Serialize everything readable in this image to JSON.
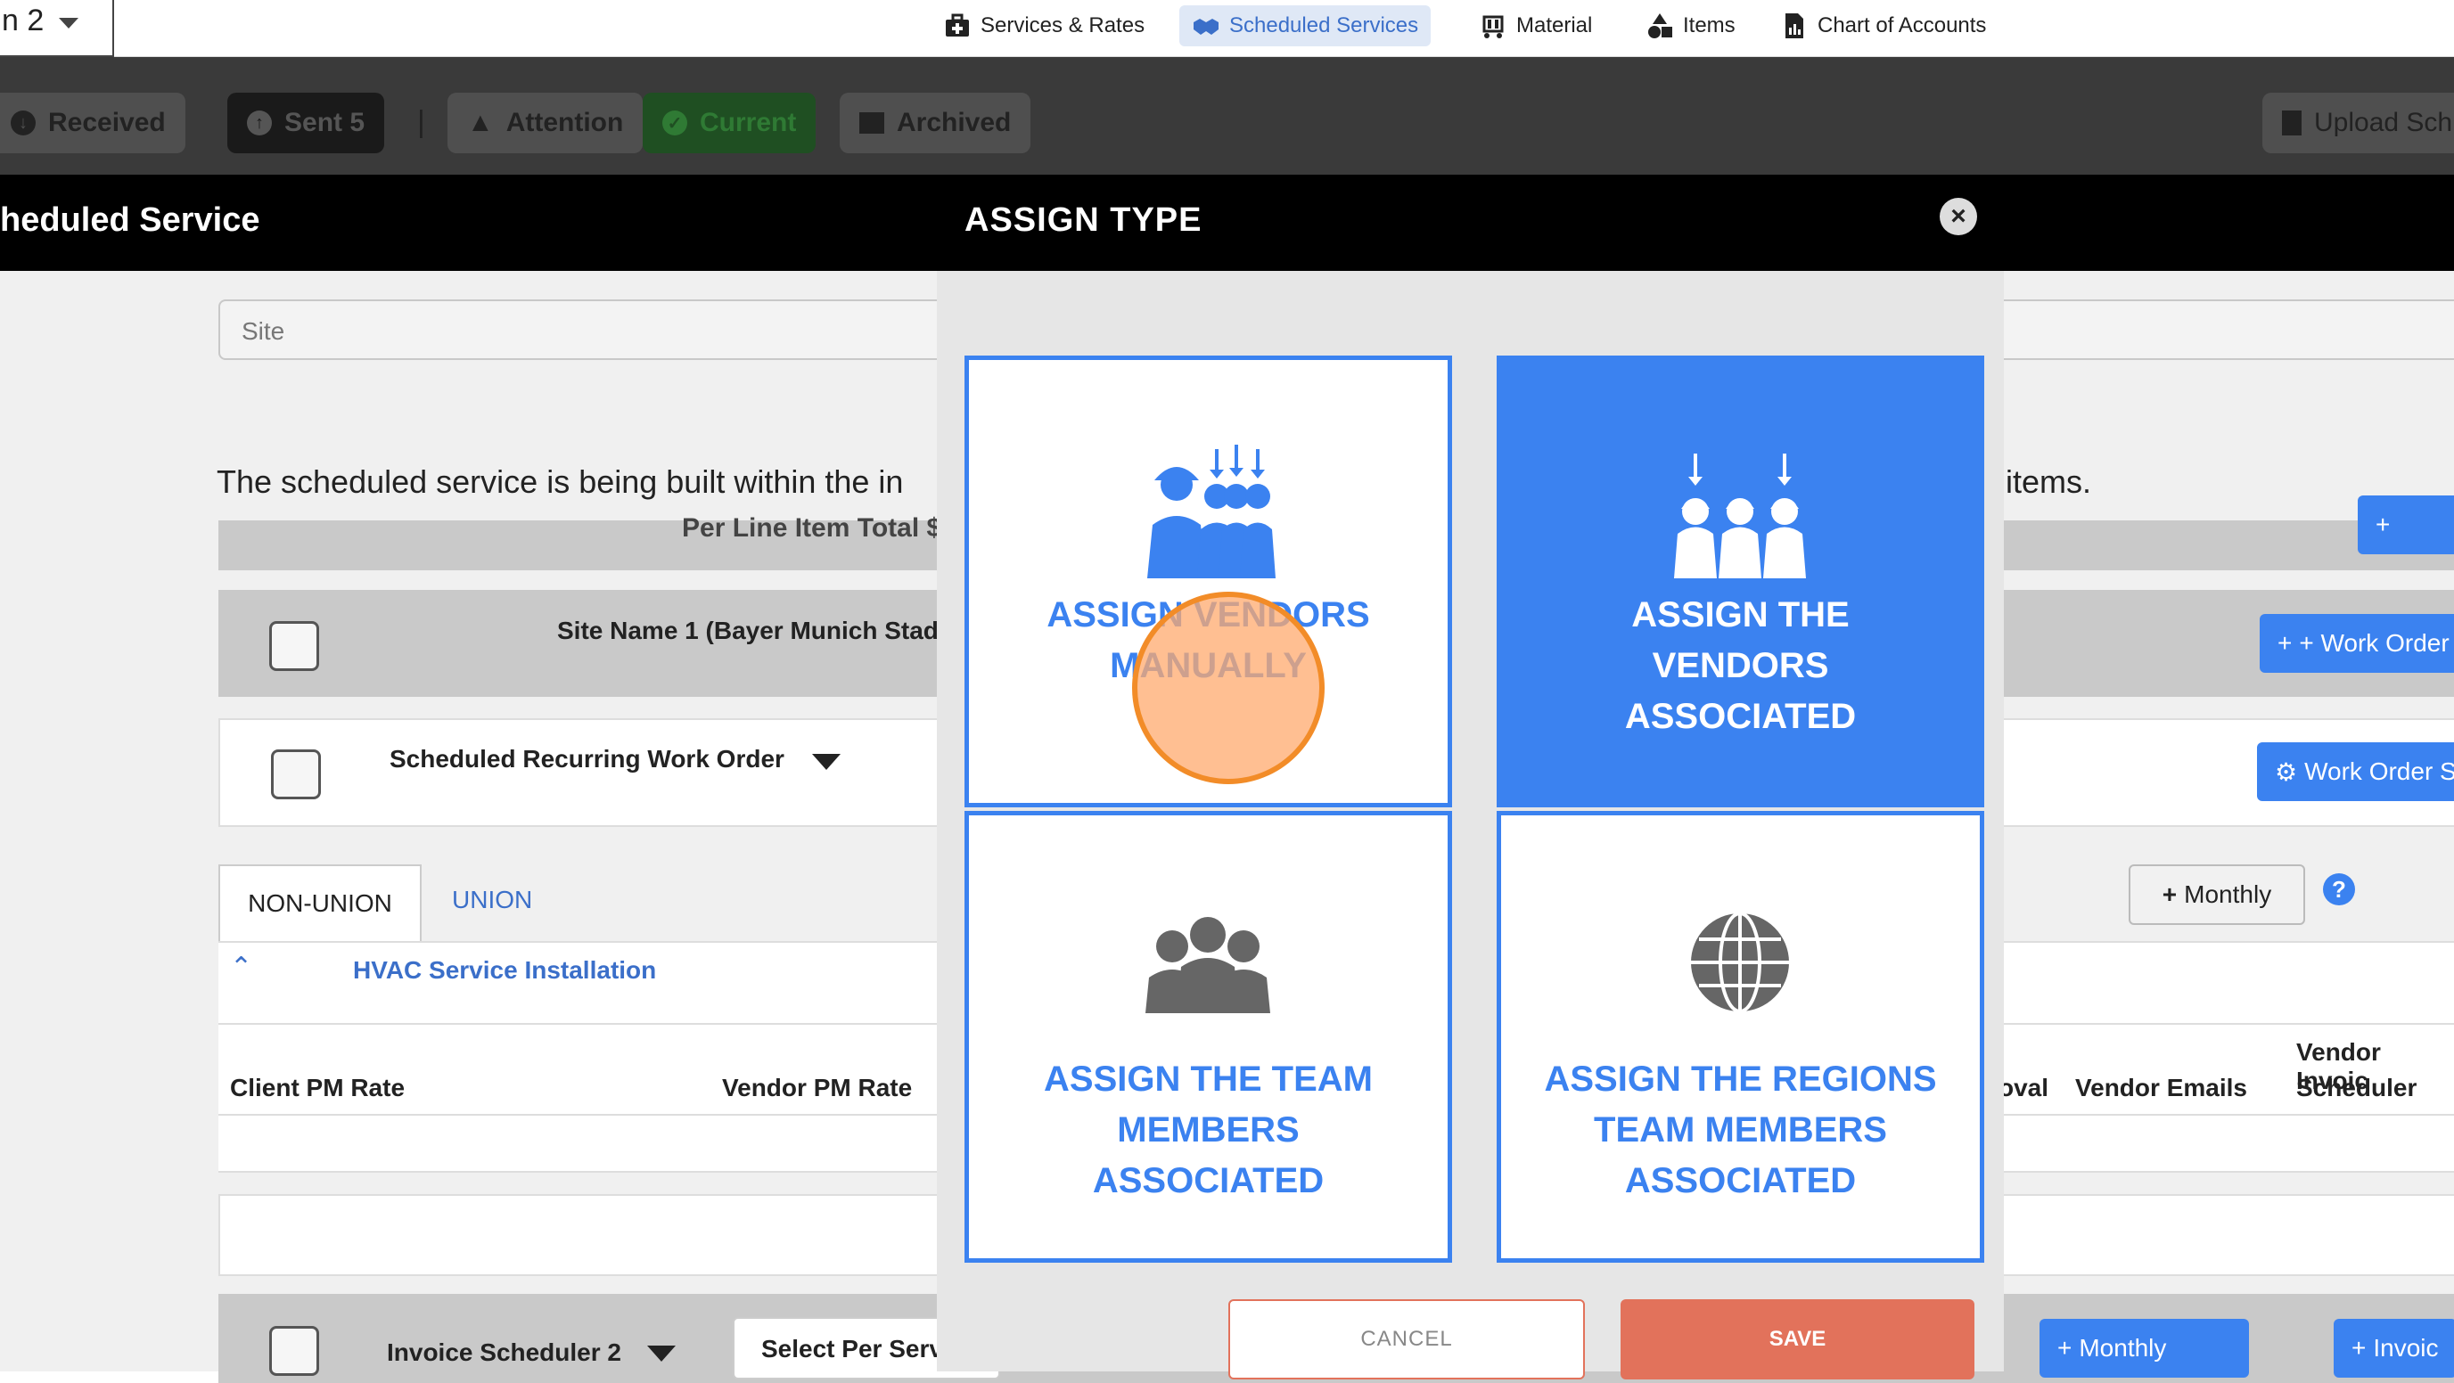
{
  "top_nav": {
    "left_select_value": "n 2",
    "items": [
      {
        "label": "Services & Rates",
        "icon": "medical-kit-icon"
      },
      {
        "label": "Scheduled Services",
        "icon": "handshake-icon",
        "active": true
      },
      {
        "label": "Material",
        "icon": "cart-icon"
      },
      {
        "label": "Items",
        "icon": "shapes-icon"
      },
      {
        "label": "Chart of Accounts",
        "icon": "document-chart-icon"
      }
    ]
  },
  "filters": {
    "received": "Received",
    "sent": "Sent 5",
    "separator": "|",
    "attention": "Attention",
    "current": "Current",
    "archived": "Archived",
    "upload": "Upload Sch"
  },
  "page": {
    "title_left": "heduled Service",
    "site_placeholder": "Site",
    "info_text_start": "The scheduled service is being built within the in",
    "info_text_end": "items.",
    "hidden_line": "Per Line Item Total $",
    "site_row_label": "Site Name 1 (Bayer Munich Stad",
    "recurring_label": "Scheduled Recurring Work Order",
    "work_order_btn": "+ Work Order t",
    "work_order_settings_btn": "Work Order S",
    "tab_nonunion": "NON-UNION",
    "tab_union": "UNION",
    "monthly_btn": "Monthly",
    "section_title": "HVAC Service Installation",
    "col_client_pm": "Client PM Rate",
    "col_vendor_pm": "Vendor PM Rate",
    "col_approval": "oval",
    "col_vendor_emails": "Vendor Emails",
    "col_vendor_invoice": "Vendor Invoic",
    "col_scheduler": "Scheduler",
    "invoice_scheduler": "Invoice Scheduler 2",
    "select_per_service": "Select Per Serv",
    "monthly_btn_2": "Monthly",
    "invoice_btn": "Invoic"
  },
  "modal": {
    "title": "ASSIGN TYPE",
    "cards": [
      {
        "label_lines": [
          "ASSIGN VENDORS",
          "MANUALLY"
        ],
        "selected": false
      },
      {
        "label_lines": [
          "ASSIGN THE",
          "VENDORS",
          "ASSOCIATED"
        ],
        "selected": true
      },
      {
        "label_lines": [
          "ASSIGN THE TEAM",
          "MEMBERS",
          "ASSOCIATED"
        ],
        "selected": false
      },
      {
        "label_lines": [
          "ASSIGN THE REGIONS",
          "TEAM MEMBERS",
          "ASSOCIATED"
        ],
        "selected": false
      }
    ],
    "cancel": "CANCEL",
    "save": "SAVE"
  },
  "colors": {
    "accent": "#3b82f0",
    "save": "#e2725b",
    "active_nav_bg": "#dfe8f6"
  }
}
